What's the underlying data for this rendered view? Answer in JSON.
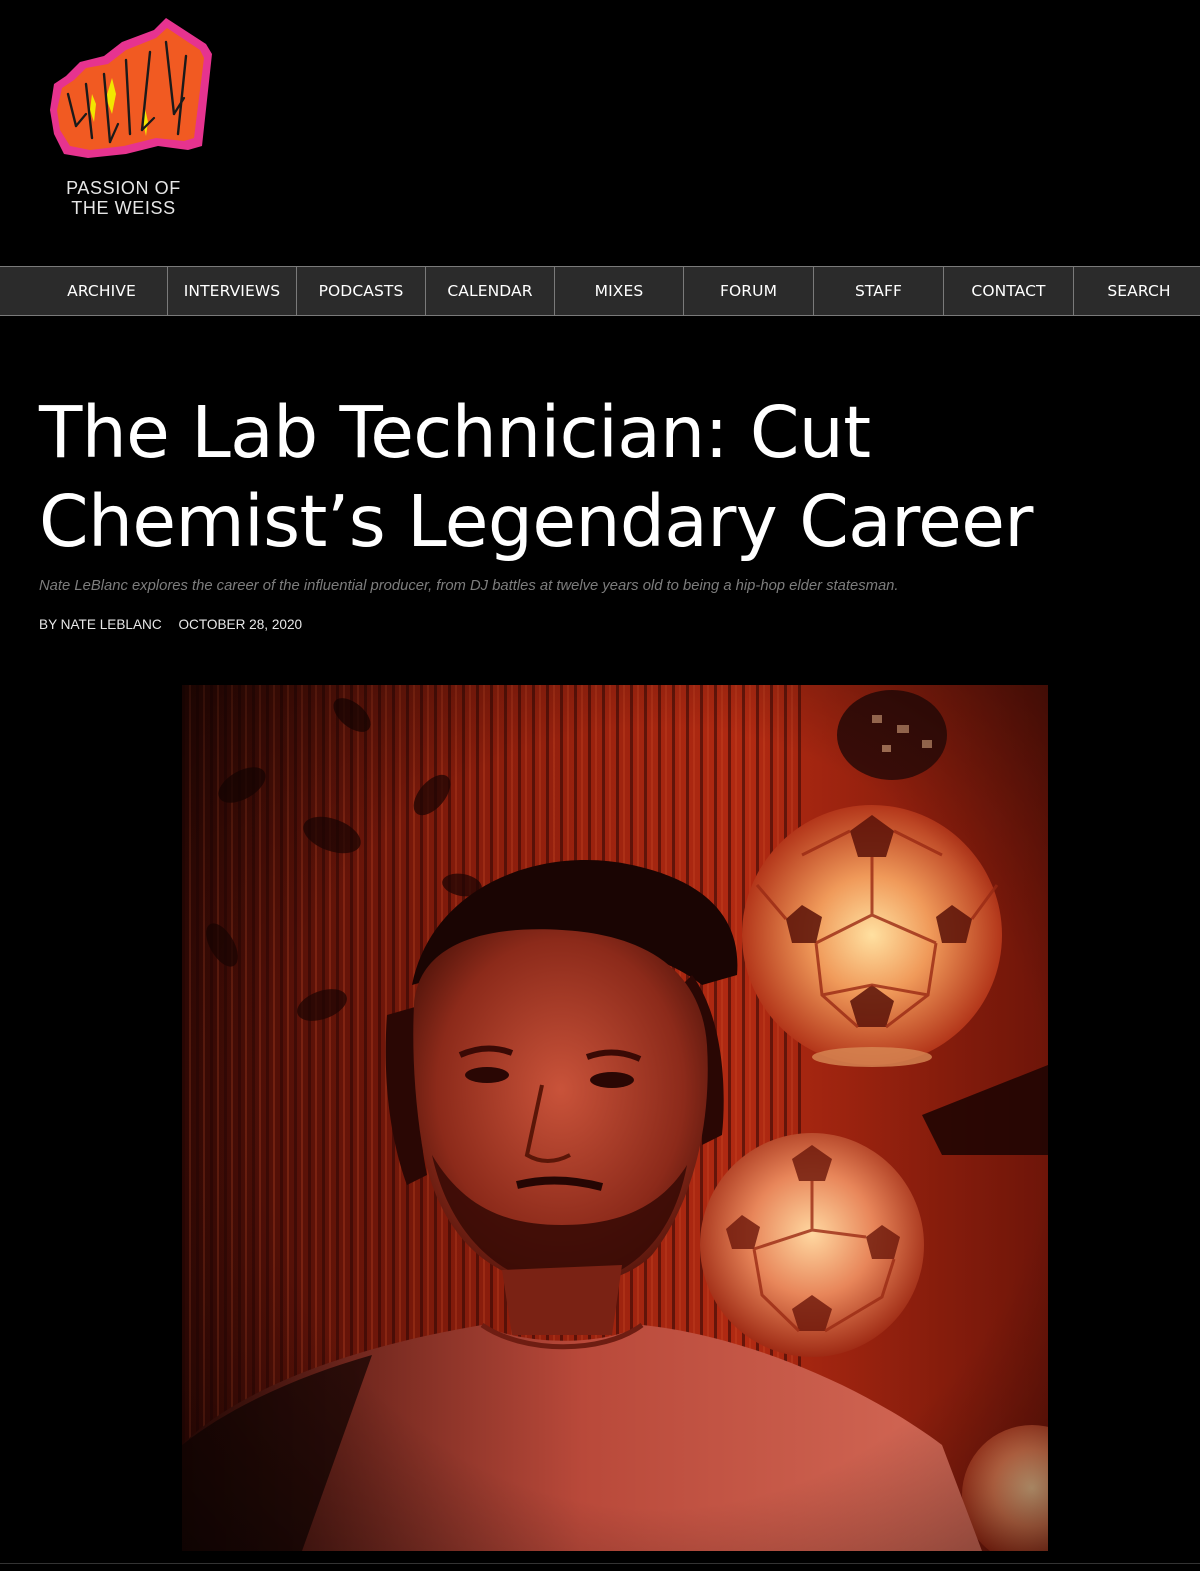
{
  "site": {
    "logo_line1": "PASSION OF",
    "logo_line2": "THE WEISS",
    "logo_colors": {
      "fill": "#f15a22",
      "outline": "#e6338f",
      "accent": "#f2e600"
    }
  },
  "nav": {
    "items": [
      {
        "label": "ARCHIVE"
      },
      {
        "label": "INTERVIEWS"
      },
      {
        "label": "PODCASTS"
      },
      {
        "label": "CALENDAR"
      },
      {
        "label": "MIXES"
      },
      {
        "label": "FORUM"
      },
      {
        "label": "STAFF"
      },
      {
        "label": "CONTACT"
      },
      {
        "label": "SEARCH"
      }
    ]
  },
  "article": {
    "title_line1": "The Lab Technician: Cut",
    "title_line2": "Chemist’s Legendary Career",
    "subtitle": "Nate LeBlanc explores the career of the influential producer, from DJ battles at twelve years old to being a hip-hop elder statesman.",
    "byline_prefix": "BY",
    "author": "NATE LEBLANC",
    "date": "OCTOBER 28, 2020",
    "hero_image": "photo-portrait-red-lamps"
  },
  "colors": {
    "background": "#000000",
    "nav_bg": "#2b2b2b",
    "nav_divider": "#7a7a7a",
    "subtitle_gray": "#7d7d7d"
  }
}
